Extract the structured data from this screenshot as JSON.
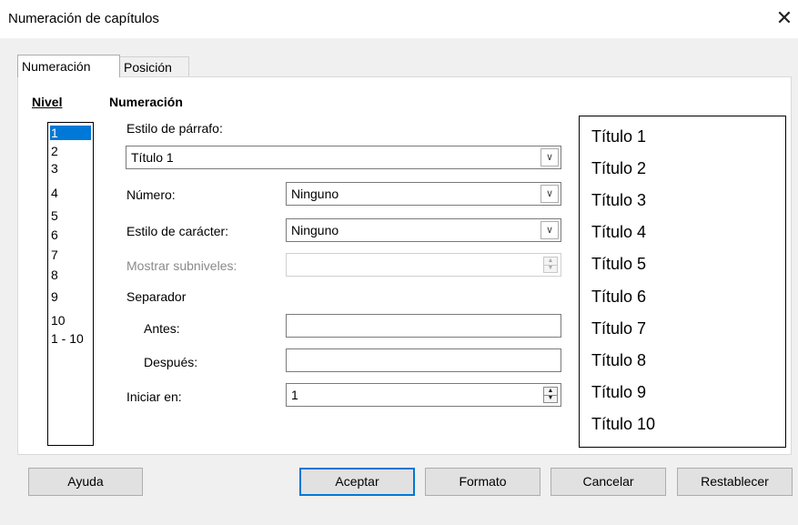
{
  "window": {
    "title": "Numeración de capítulos",
    "close_glyph": "✕"
  },
  "tabs": [
    {
      "label": "Numeración",
      "active": true
    },
    {
      "label": "Posición",
      "active": false
    }
  ],
  "level": {
    "heading": "Nivel",
    "items": [
      "1",
      "2",
      "3",
      "4",
      "5",
      "6",
      "7",
      "8",
      "9",
      "10",
      "1 - 10"
    ],
    "selected": "1"
  },
  "numbering": {
    "heading": "Numeración",
    "paragraph_style_label": "Estilo de párrafo:",
    "paragraph_style_value": "Título 1",
    "number_label": "Número:",
    "number_value": "Ninguno",
    "char_style_label": "Estilo de carácter:",
    "char_style_value": "Ninguno",
    "show_sublevels_label": "Mostrar subniveles:",
    "separator_label": "Separador",
    "before_label": "Antes:",
    "after_label": "Después:",
    "start_at_label": "Iniciar en:",
    "start_at_value": "1"
  },
  "preview": {
    "lines": [
      "Título 1",
      "Título 2",
      "Título 3",
      "Título 4",
      "Título 5",
      "Título 6",
      "Título 7",
      "Título 8",
      "Título 9",
      "Título 10"
    ]
  },
  "buttons": {
    "help": "Ayuda",
    "ok": "Aceptar",
    "format": "Formato",
    "cancel": "Cancelar",
    "reset": "Restablecer"
  },
  "colors": {
    "selection": "#0078d7",
    "default_button_border": "#0078d7"
  }
}
